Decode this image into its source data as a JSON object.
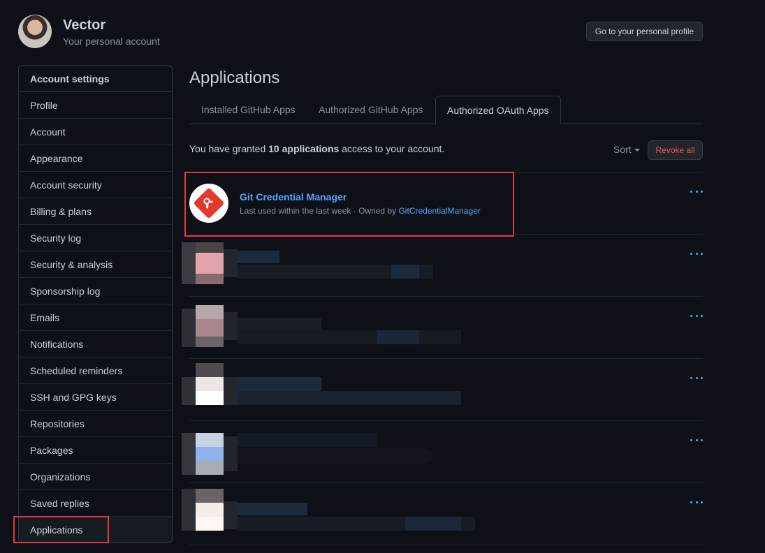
{
  "user": {
    "name": "Vector",
    "subtitle": "Your personal account",
    "profile_button": "Go to your personal profile"
  },
  "sidebar": {
    "heading": "Account settings",
    "items": [
      {
        "label": "Profile"
      },
      {
        "label": "Account"
      },
      {
        "label": "Appearance"
      },
      {
        "label": "Account security"
      },
      {
        "label": "Billing & plans"
      },
      {
        "label": "Security log"
      },
      {
        "label": "Security & analysis"
      },
      {
        "label": "Sponsorship log"
      },
      {
        "label": "Emails"
      },
      {
        "label": "Notifications"
      },
      {
        "label": "Scheduled reminders"
      },
      {
        "label": "SSH and GPG keys"
      },
      {
        "label": "Repositories"
      },
      {
        "label": "Packages"
      },
      {
        "label": "Organizations"
      },
      {
        "label": "Saved replies"
      },
      {
        "label": "Applications",
        "active": true
      }
    ]
  },
  "main": {
    "title": "Applications",
    "tabs": [
      {
        "label": "Installed GitHub Apps"
      },
      {
        "label": "Authorized GitHub Apps"
      },
      {
        "label": "Authorized OAuth Apps",
        "active": true
      }
    ],
    "summary": {
      "prefix": "You have granted",
      "count": "10 applications",
      "suffix": "access to your account."
    },
    "sort_label": "Sort",
    "revoke_all": "Revoke all",
    "apps": [
      {
        "name": "Git Credential Manager",
        "meta": "Last used within the last week · Owned by",
        "owner": "GitCredentialManager"
      }
    ]
  },
  "colors": {
    "accent_link": "#58a6ff",
    "danger": "#f85149",
    "highlight": "#e5383b",
    "background": "#0d1117"
  }
}
